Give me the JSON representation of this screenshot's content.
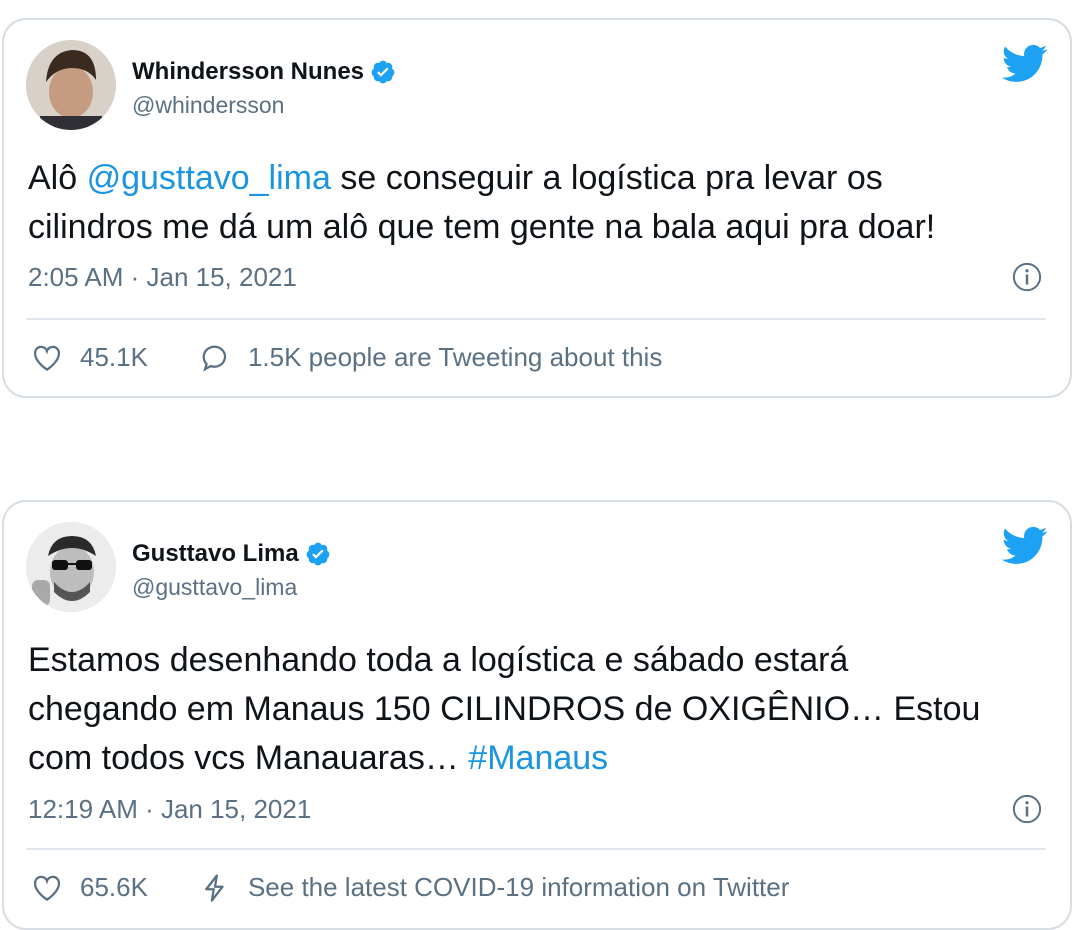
{
  "tweets": [
    {
      "author": "Whindersson Nunes",
      "handle": "@whindersson",
      "text_parts": [
        "Alô ",
        "@gusttavo_lima",
        " se conseguir a logística pra levar os\ncilindros me dá um alô que tem gente na bala aqui pra doar!"
      ],
      "timestamp": "2:05 AM · Jan 15, 2021",
      "likes": "45.1K",
      "secondary_action": "1.5K people are Tweeting about this"
    },
    {
      "author": "Gusttavo Lima",
      "handle": "@gusttavo_lima",
      "text_parts": [
        "Estamos desenhando toda a logística e sábado estará\nchegando em Manaus 150 CILINDROS de OXIGÊNIO… Estou\ncom todos vcs Manauaras… ",
        "#Manaus"
      ],
      "timestamp": "12:19 AM · Jan 15, 2021",
      "likes": "65.6K",
      "secondary_action": "See the latest COVID-19 information on Twitter"
    }
  ],
  "colors": {
    "link": "#1b95e0",
    "twitter_blue": "#1da1f2",
    "muted": "#5b7083"
  },
  "icons": [
    "verified-badge-icon",
    "twitter-bird-icon",
    "info-icon",
    "heart-icon",
    "reply-bubble-icon",
    "lightning-icon"
  ]
}
